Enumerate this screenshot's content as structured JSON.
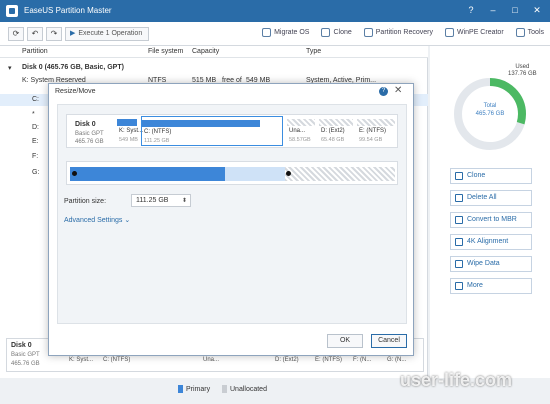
{
  "app": {
    "title": "EaseUS Partition Master"
  },
  "toolbar": {
    "refresh": "⟳",
    "undo": "↶",
    "redo": "↷",
    "execute": "Execute 1 Operation",
    "items": [
      {
        "label": "Migrate OS"
      },
      {
        "label": "Clone"
      },
      {
        "label": "Partition Recovery"
      },
      {
        "label": "WinPE Creator"
      },
      {
        "label": "Tools"
      }
    ]
  },
  "table": {
    "headers": {
      "partition": "Partition",
      "filesystem": "File system",
      "capacity": "Capacity",
      "type": "Type"
    },
    "disk_header": "Disk 0 (465.76 GB, Basic, GPT)",
    "rows": [
      {
        "name": "K: System Reserved",
        "fs": "NTFS",
        "cap": "515 MB",
        "free": "free of",
        "total": "549 MB",
        "type": "System, Active, Prim..."
      },
      {
        "name": "C:"
      },
      {
        "name": "*"
      },
      {
        "name": "D:"
      },
      {
        "name": "E:"
      },
      {
        "name": "F:"
      },
      {
        "name": "G:"
      }
    ]
  },
  "bottom_disk": {
    "name": "Disk 0",
    "type": "Basic GPT",
    "size": "465.76 GB",
    "segments": [
      {
        "label": "K: Syst..."
      },
      {
        "label": "C: (NTFS)"
      },
      {
        "label": "Una..."
      },
      {
        "label": "D: (Ext2)"
      },
      {
        "label": "E: (NTFS)"
      },
      {
        "label": "F: (N..."
      },
      {
        "label": "G: (N..."
      }
    ]
  },
  "legend": {
    "primary": "Primary",
    "unallocated": "Unallocated",
    "primary_color": "#3d86d8",
    "unallocated_color": "#c9cdd2"
  },
  "right_panel": {
    "used_label": "Used",
    "used_value": "137.76 GB",
    "total_label": "Total",
    "total_value": "465.76 GB",
    "used_fraction": 0.296,
    "actions": [
      {
        "label": "Clone"
      },
      {
        "label": "Delete All"
      },
      {
        "label": "Convert to MBR"
      },
      {
        "label": "4K Alignment"
      },
      {
        "label": "Wipe Data"
      },
      {
        "label": "More"
      }
    ]
  },
  "dialog": {
    "title": "Resize/Move",
    "help": "?",
    "close": "✕",
    "disk": {
      "name": "Disk 0",
      "type": "Basic GPT",
      "size": "465.76 GB",
      "segments": [
        {
          "label": "K: Syst...",
          "size": "549 MB"
        },
        {
          "label": "C: (NTFS)",
          "size": "111.25 GB"
        },
        {
          "label": "Una...",
          "size": "58.57GB"
        },
        {
          "label": "D: (Ext2)",
          "size": "65.48 GB"
        },
        {
          "label": "E: (NTFS)",
          "size": "99.54 GB"
        }
      ]
    },
    "partition_size_label": "Partition size:",
    "partition_size_value": "111.25 GB",
    "advanced_settings": "Advanced Settings ⌄",
    "ok": "OK",
    "cancel": "Cancel"
  },
  "watermark": "user-life.com"
}
